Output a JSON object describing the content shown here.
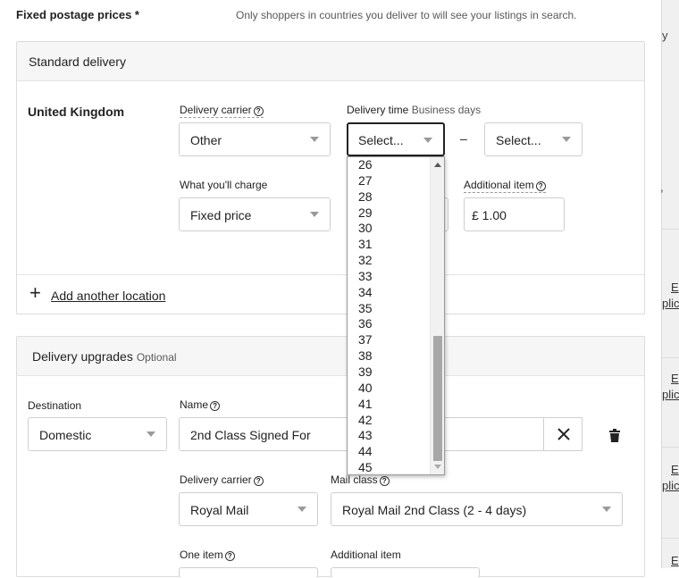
{
  "heading": {
    "title": "Fixed postage prices *",
    "hint": "Only shoppers in countries you deliver to will see your listings in search."
  },
  "standard": {
    "header": "Standard delivery",
    "country": "United Kingdom",
    "carrier_label": "Delivery carrier",
    "carrier_value": "Other",
    "time_label": "Delivery time",
    "time_sub": "Business days",
    "time_from": "Select...",
    "dash": "–",
    "time_to": "Select...",
    "charge_label": "What you'll charge",
    "charge_value": "Fixed price",
    "additional_label": "Additional item",
    "additional_value": "£ 1.00",
    "add_location": "Add another location",
    "dropdown_options": [
      "26",
      "27",
      "28",
      "29",
      "30",
      "31",
      "32",
      "33",
      "34",
      "35",
      "36",
      "37",
      "38",
      "39",
      "40",
      "41",
      "42",
      "43",
      "44",
      "45"
    ]
  },
  "upgrades": {
    "header": "Delivery upgrades",
    "optional": "Optional",
    "destination_label": "Destination",
    "destination_value": "Domestic",
    "name_label": "Name",
    "name_value": "2nd Class Signed For",
    "carrier_label": "Delivery carrier",
    "carrier_value": "Royal Mail",
    "mail_class_label": "Mail class",
    "mail_class_value": "Royal Mail 2nd Class (2 - 4 days)",
    "one_item_label": "One item",
    "additional_label": "Additional item"
  },
  "side_strip": {
    "frag1": "y",
    "frag2": ",",
    "link_a": "E",
    "link_b": "plic",
    "link_c": "E",
    "link_d": "plic",
    "link_e": "E",
    "link_f": "plic",
    "link_g": "E"
  },
  "icons": {
    "close": "close-icon",
    "trash": "trash-icon",
    "plus": "plus-icon",
    "help": "help-icon"
  }
}
